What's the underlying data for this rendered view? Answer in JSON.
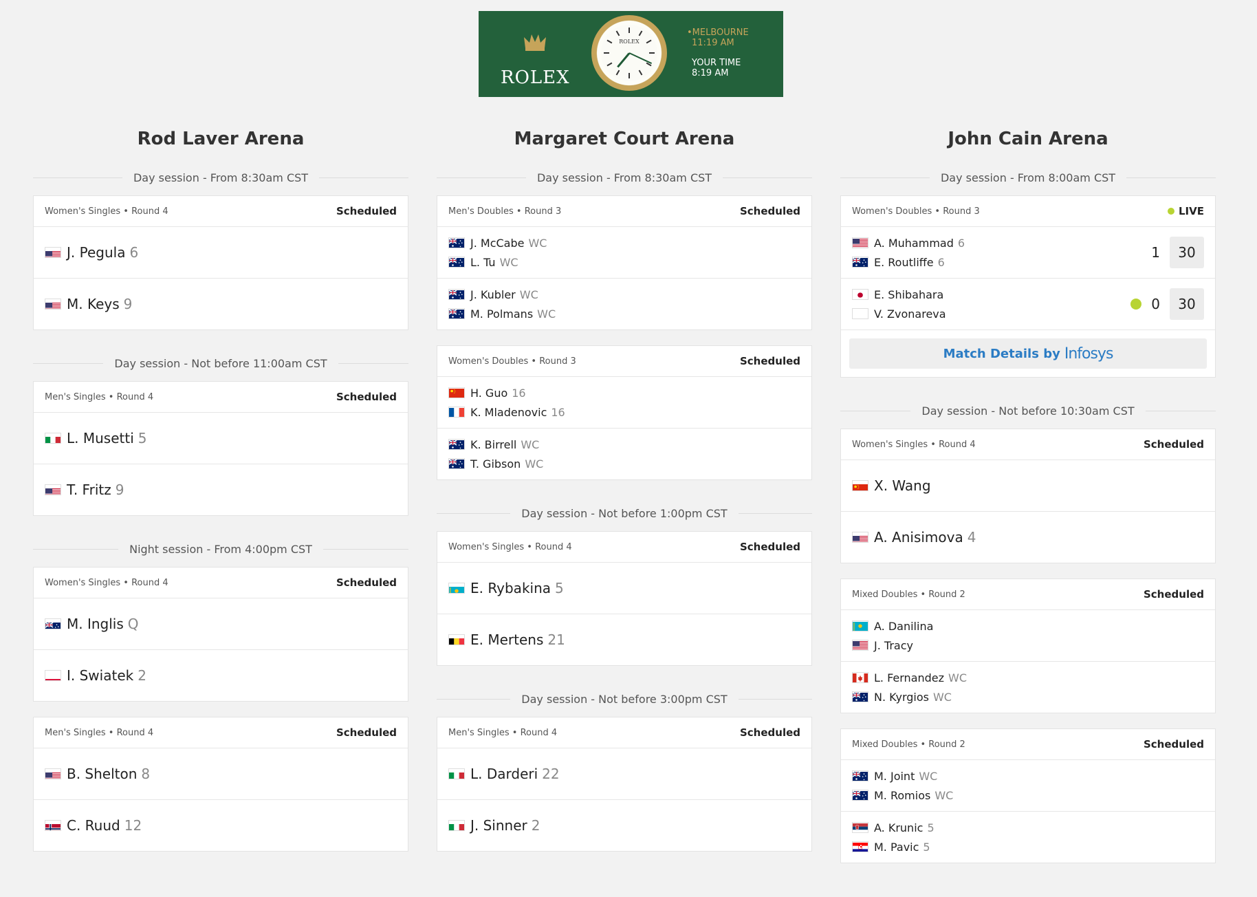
{
  "banner": {
    "brand": "ROLEX",
    "clock_logo": "ROLEX",
    "melbourne_label": "•MELBOURNE",
    "melbourne_time": "11:19 AM",
    "your_time_label": "YOUR TIME",
    "your_time": "8:19 AM",
    "colors": {
      "background": "#23613b",
      "gold": "#c6a45a"
    }
  },
  "courts": [
    {
      "name": "Rod Laver Arena",
      "blocks": [
        {
          "session": "Day session - From 8:30am CST",
          "matches": [
            {
              "comp": "Women's Singles • Round 4",
              "status": "Scheduled",
              "type": "single",
              "teams": [
                {
                  "players": [
                    {
                      "flag": "usa-flag-icon",
                      "name": "J. Pegula",
                      "seed": "6"
                    }
                  ]
                },
                {
                  "players": [
                    {
                      "flag": "usa-flag-icon",
                      "name": "M. Keys",
                      "seed": "9"
                    }
                  ]
                }
              ]
            }
          ]
        },
        {
          "session": "Day session - Not before 11:00am CST",
          "matches": [
            {
              "comp": "Men's Singles • Round 4",
              "status": "Scheduled",
              "type": "single",
              "teams": [
                {
                  "players": [
                    {
                      "flag": "italy-flag-icon",
                      "name": "L. Musetti",
                      "seed": "5"
                    }
                  ]
                },
                {
                  "players": [
                    {
                      "flag": "usa-flag-icon",
                      "name": "T. Fritz",
                      "seed": "9"
                    }
                  ]
                }
              ]
            }
          ]
        },
        {
          "session": "Night session - From 4:00pm CST",
          "matches": [
            {
              "comp": "Women's Singles • Round 4",
              "status": "Scheduled",
              "type": "single",
              "teams": [
                {
                  "players": [
                    {
                      "flag": "australia-flag-icon",
                      "name": "M. Inglis",
                      "seed": "Q"
                    }
                  ]
                },
                {
                  "players": [
                    {
                      "flag": "poland-flag-icon",
                      "name": "I. Swiatek",
                      "seed": "2"
                    }
                  ]
                }
              ]
            },
            {
              "comp": "Men's Singles • Round 4",
              "status": "Scheduled",
              "type": "single",
              "teams": [
                {
                  "players": [
                    {
                      "flag": "usa-flag-icon",
                      "name": "B. Shelton",
                      "seed": "8"
                    }
                  ]
                },
                {
                  "players": [
                    {
                      "flag": "norway-flag-icon",
                      "name": "C. Ruud",
                      "seed": "12"
                    }
                  ]
                }
              ]
            }
          ]
        }
      ]
    },
    {
      "name": "Margaret Court Arena",
      "blocks": [
        {
          "session": "Day session - From 8:30am CST",
          "matches": [
            {
              "comp": "Men's Doubles • Round 3",
              "status": "Scheduled",
              "type": "double",
              "teams": [
                {
                  "players": [
                    {
                      "flag": "australia-flag-icon",
                      "name": "J. McCabe",
                      "seed": "WC"
                    },
                    {
                      "flag": "australia-flag-icon",
                      "name": "L. Tu",
                      "seed": "WC"
                    }
                  ]
                },
                {
                  "players": [
                    {
                      "flag": "australia-flag-icon",
                      "name": "J. Kubler",
                      "seed": "WC"
                    },
                    {
                      "flag": "australia-flag-icon",
                      "name": "M. Polmans",
                      "seed": "WC"
                    }
                  ]
                }
              ]
            },
            {
              "comp": "Women's Doubles • Round 3",
              "status": "Scheduled",
              "type": "double",
              "teams": [
                {
                  "players": [
                    {
                      "flag": "china-flag-icon",
                      "name": "H. Guo",
                      "seed": "16"
                    },
                    {
                      "flag": "france-flag-icon",
                      "name": "K. Mladenovic",
                      "seed": "16"
                    }
                  ]
                },
                {
                  "players": [
                    {
                      "flag": "australia-flag-icon",
                      "name": "K. Birrell",
                      "seed": "WC"
                    },
                    {
                      "flag": "australia-flag-icon",
                      "name": "T. Gibson",
                      "seed": "WC"
                    }
                  ]
                }
              ]
            }
          ]
        },
        {
          "session": "Day session - Not before 1:00pm CST",
          "matches": [
            {
              "comp": "Women's Singles • Round 4",
              "status": "Scheduled",
              "type": "single",
              "teams": [
                {
                  "players": [
                    {
                      "flag": "kazakhstan-flag-icon",
                      "name": "E. Rybakina",
                      "seed": "5"
                    }
                  ]
                },
                {
                  "players": [
                    {
                      "flag": "belgium-flag-icon",
                      "name": "E. Mertens",
                      "seed": "21"
                    }
                  ]
                }
              ]
            }
          ]
        },
        {
          "session": "Day session - Not before 3:00pm CST",
          "matches": [
            {
              "comp": "Men's Singles • Round 4",
              "status": "Scheduled",
              "type": "single",
              "teams": [
                {
                  "players": [
                    {
                      "flag": "italy-flag-icon",
                      "name": "L. Darderi",
                      "seed": "22"
                    }
                  ]
                },
                {
                  "players": [
                    {
                      "flag": "italy-flag-icon",
                      "name": "J. Sinner",
                      "seed": "2"
                    }
                  ]
                }
              ]
            }
          ]
        }
      ]
    },
    {
      "name": "John Cain Arena",
      "blocks": [
        {
          "session": "Day session - From 8:00am CST",
          "matches": [
            {
              "comp": "Women's Doubles • Round 3",
              "status": "LIVE",
              "live": true,
              "type": "double",
              "details_label": "Match Details by",
              "details_sponsor": "Infosys",
              "teams": [
                {
                  "players": [
                    {
                      "flag": "usa-flag-icon",
                      "name": "A. Muhammad",
                      "seed": "6"
                    },
                    {
                      "flag": "australia-flag-icon",
                      "name": "E. Routliffe",
                      "seed": "6"
                    }
                  ],
                  "sets": "1",
                  "points": "30",
                  "serving": false
                },
                {
                  "players": [
                    {
                      "flag": "japan-flag-icon",
                      "name": "E. Shibahara",
                      "seed": ""
                    },
                    {
                      "flag": "blank-flag-icon",
                      "name": "V. Zvonareva",
                      "seed": ""
                    }
                  ],
                  "sets": "0",
                  "points": "30",
                  "serving": true
                }
              ]
            }
          ]
        },
        {
          "session": "Day session - Not before 10:30am CST",
          "matches": [
            {
              "comp": "Women's Singles • Round 4",
              "status": "Scheduled",
              "type": "single",
              "teams": [
                {
                  "players": [
                    {
                      "flag": "china-flag-icon",
                      "name": "X. Wang",
                      "seed": ""
                    }
                  ]
                },
                {
                  "players": [
                    {
                      "flag": "usa-flag-icon",
                      "name": "A. Anisimova",
                      "seed": "4"
                    }
                  ]
                }
              ]
            },
            {
              "comp": "Mixed Doubles • Round 2",
              "status": "Scheduled",
              "type": "double",
              "teams": [
                {
                  "players": [
                    {
                      "flag": "kazakhstan-flag-icon",
                      "name": "A. Danilina",
                      "seed": ""
                    },
                    {
                      "flag": "usa-flag-icon",
                      "name": "J. Tracy",
                      "seed": ""
                    }
                  ]
                },
                {
                  "players": [
                    {
                      "flag": "canada-flag-icon",
                      "name": "L. Fernandez",
                      "seed": "WC"
                    },
                    {
                      "flag": "australia-flag-icon",
                      "name": "N. Kyrgios",
                      "seed": "WC"
                    }
                  ]
                }
              ]
            },
            {
              "comp": "Mixed Doubles • Round 2",
              "status": "Scheduled",
              "type": "double",
              "teams": [
                {
                  "players": [
                    {
                      "flag": "australia-flag-icon",
                      "name": "M. Joint",
                      "seed": "WC"
                    },
                    {
                      "flag": "australia-flag-icon",
                      "name": "M. Romios",
                      "seed": "WC"
                    }
                  ]
                },
                {
                  "players": [
                    {
                      "flag": "serbia-flag-icon",
                      "name": "A. Krunic",
                      "seed": "5"
                    },
                    {
                      "flag": "croatia-flag-icon",
                      "name": "M. Pavic",
                      "seed": "5"
                    }
                  ]
                }
              ]
            }
          ]
        }
      ]
    }
  ],
  "colors": {
    "live_dot": "#b8d433",
    "details_link": "#2b7cc4",
    "page_bg": "#f2f2f2"
  }
}
